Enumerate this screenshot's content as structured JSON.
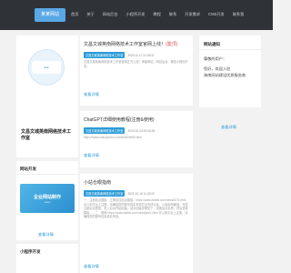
{
  "header": {
    "logo": "某某网站",
    "nav": [
      "首页",
      "关于",
      "网站后台",
      "小程序开发",
      "教程",
      "联系",
      "开发需求",
      "CMS开发",
      "联系我"
    ]
  },
  "profile": {
    "name": "文昌文城英南网络技术工作室",
    "more": "查看详情"
  },
  "webdev": {
    "title": "网站开发",
    "banner_title": "企业网站制作",
    "banner_sub": "www",
    "more": "查看详情"
  },
  "miniapp": {
    "title": "小程序开发"
  },
  "posts": [
    {
      "title": "文昌文城英南网络技术工作室官网上线！",
      "tag": "(置顶)",
      "category": "文昌文城英南网络技术工作室",
      "date": "2020-11-17 21:28:37",
      "excerpt": "文昌文城英南网络技术工作室官网正式上线！承接网站、网站后台、微信小程序开发。",
      "more": "查看详情"
    },
    {
      "title": "ChatGPT详细使用教程(注册&使用)",
      "tag": "",
      "category": "文昌文城英南网络技术工作室",
      "date": "2023-02-24 09:40:28",
      "excerpt": "https://www.zhangluobi.com/article/4680.html",
      "more": "查看详情"
    },
    {
      "title": "小站仓眼指南",
      "tag": "",
      "category": "文昌文城英南网络技术工作室",
      "date": "2021-10-16 11:25:22",
      "excerpt": "一、注册站点链接：立即前往站点链接。https://www.dslbbt.com/news/87/1.html 可以到平台上注册，请确保您的账号真实有效并且完成认证，以免影响使用。完成注册后请登录，进入后台开始创建。站点创建步骤如下：设置站点名称，然后选择模板……二、推荐 https://www.dslbbt.com/news/jks/1.html 可以到平台上注册，请确保您的账号信息真实有效。",
      "more": "查看详情"
    }
  ],
  "notice": {
    "title": "网站通知",
    "lines": [
      "尊敬的用户：",
      "您好，欢迎入驻",
      "海南网站建设优质服务商"
    ],
    "more": "查看详情"
  }
}
